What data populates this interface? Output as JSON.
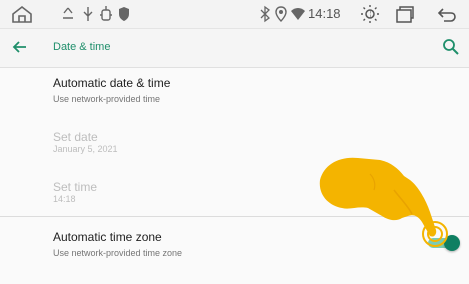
{
  "status_bar": {
    "time": "14:18",
    "icons": [
      "home-icon",
      "bluetooth-icon",
      "location-icon",
      "wifi-icon",
      "brightness-icon",
      "recent-apps-icon",
      "back-icon"
    ]
  },
  "app_bar": {
    "title": "Date & time"
  },
  "settings": [
    {
      "title": "Automatic date & time",
      "subtitle": "Use network-provided time",
      "enabled": true
    },
    {
      "title": "Set date",
      "subtitle": "January 5, 2021",
      "enabled": false
    },
    {
      "title": "Set time",
      "subtitle": "14:18",
      "enabled": false
    },
    {
      "title": "Automatic time zone",
      "subtitle": "Use network-provided time zone",
      "enabled": true,
      "toggle_on": true
    }
  ],
  "colors": {
    "accent": "#0f7f62",
    "title": "#1f8f6b",
    "hand": "#f4b400"
  }
}
